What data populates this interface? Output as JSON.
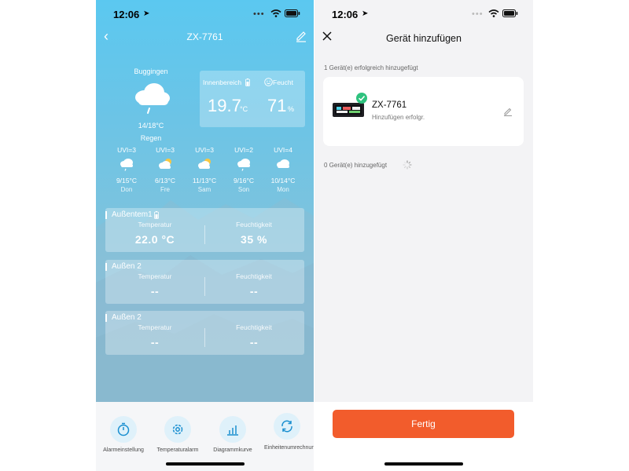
{
  "left": {
    "status": {
      "time": "12:06"
    },
    "nav": {
      "title": "ZX-7761"
    },
    "weather": {
      "city": "Buggingen",
      "range": "14/18°C",
      "condition": "Regen"
    },
    "indoor": {
      "label_temp": "Innenbereich",
      "label_humidity": "Feucht",
      "temp": "19.7",
      "temp_unit": "°C",
      "humidity": "71",
      "humidity_unit": "%"
    },
    "forecast": [
      {
        "uvi": "UVI=3",
        "temps": "9/15°C",
        "day": "Don",
        "icon": "cloud-rain-icon"
      },
      {
        "uvi": "UVI=3",
        "temps": "6/13°C",
        "day": "Fre",
        "icon": "partly-cloudy-icon"
      },
      {
        "uvi": "UVI=3",
        "temps": "11/13°C",
        "day": "Sam",
        "icon": "partly-cloudy-icon"
      },
      {
        "uvi": "UVI=2",
        "temps": "9/16°C",
        "day": "Son",
        "icon": "cloud-rain-icon"
      },
      {
        "uvi": "UVI=4",
        "temps": "10/14°C",
        "day": "Mon",
        "icon": "cloud-icon"
      }
    ],
    "sensors": [
      {
        "name": "Außentem1",
        "temp_label": "Temperatur",
        "hum_label": "Feuchtigkeit",
        "temp": "22.0 °C",
        "hum": "35 %"
      },
      {
        "name": "Außen 2",
        "temp_label": "Temperatur",
        "hum_label": "Feuchtigkeit",
        "temp": "--",
        "hum": "--"
      },
      {
        "name": "Außen 2",
        "temp_label": "Temperatur",
        "hum_label": "Feuchtigkeit",
        "temp": "--",
        "hum": "--"
      }
    ],
    "tabs": [
      {
        "label": "Alarmeinstellung",
        "icon": "stopwatch-icon"
      },
      {
        "label": "Temperaturalarm",
        "icon": "gear-icon"
      },
      {
        "label": "Diagrammkurve",
        "icon": "chart-icon"
      },
      {
        "label": "Einheitenumrechnung",
        "icon": "refresh-icon"
      }
    ]
  },
  "right": {
    "status": {
      "time": "12:06"
    },
    "title": "Gerät hinzufügen",
    "success_count": "1 Gerät(e) erfolgreich hinzugefügt",
    "device": {
      "name": "ZX-7761",
      "status": "Hinzufügen erfolgr."
    },
    "pending_count": "0 Gerät(e) hinzugefügt",
    "done_button": "Fertig",
    "colors": {
      "button": "#f25c2c",
      "check": "#2ec27e"
    }
  }
}
